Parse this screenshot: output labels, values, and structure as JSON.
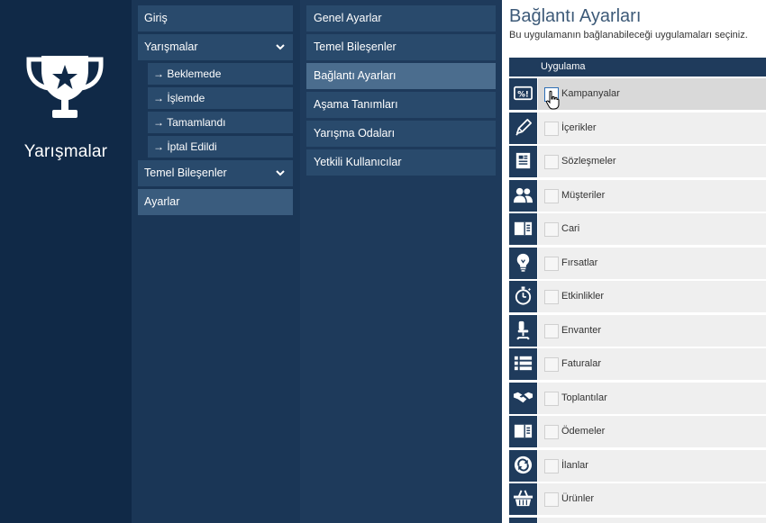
{
  "app": {
    "title": "Yarışmalar",
    "icon": "trophy-icon"
  },
  "menu": {
    "items": [
      {
        "label": "Giriş"
      },
      {
        "label": "Yarışmalar",
        "expanded": true
      },
      {
        "label": "→ Beklemede"
      },
      {
        "label": "→ İşlemde"
      },
      {
        "label": "→ Tamamlandı"
      },
      {
        "label": "→ İptal Edildi"
      },
      {
        "label": "Temel Bileşenler",
        "expanded": false
      },
      {
        "label": "Ayarlar",
        "active": true
      }
    ]
  },
  "submenu": {
    "items": [
      {
        "label": "Genel Ayarlar"
      },
      {
        "label": "Temel Bileşenler"
      },
      {
        "label": "Bağlantı Ayarları",
        "active": true
      },
      {
        "label": "Aşama Tanımları"
      },
      {
        "label": "Yarışma Odaları"
      },
      {
        "label": "Yetkili Kullanıcılar"
      }
    ]
  },
  "content": {
    "title": "Bağlantı Ayarları",
    "subtitle": "Bu uygulamanın bağlanabileceği uygulamaları seçiniz.",
    "column_header": "Uygulama",
    "apps": [
      {
        "label": "Kampanyalar",
        "icon": "percent-tag-icon",
        "checked": false
      },
      {
        "label": "İçerikler",
        "icon": "pencil-icon",
        "checked": false
      },
      {
        "label": "Sözleşmeler",
        "icon": "document-icon",
        "checked": false
      },
      {
        "label": "Müşteriler",
        "icon": "users-icon",
        "checked": false
      },
      {
        "label": "Cari",
        "icon": "ledger-icon",
        "checked": false
      },
      {
        "label": "Fırsatlar",
        "icon": "lightbulb-icon",
        "checked": false
      },
      {
        "label": "Etkinlikler",
        "icon": "stopwatch-icon",
        "checked": false
      },
      {
        "label": "Envanter",
        "icon": "office-chair-icon",
        "checked": false
      },
      {
        "label": "Faturalar",
        "icon": "list-icon",
        "checked": false
      },
      {
        "label": "Toplantılar",
        "icon": "handshake-icon",
        "checked": false
      },
      {
        "label": "Ödemeler",
        "icon": "ledger-icon",
        "checked": false
      },
      {
        "label": "İlanlar",
        "icon": "refresh-circle-icon",
        "checked": false
      },
      {
        "label": "Ürünler",
        "icon": "basket-icon",
        "checked": false
      }
    ]
  },
  "colors": {
    "rail": "#102947",
    "menu_bg": "#1a3656",
    "menu_item": "#294a6c",
    "menu_active": "#3a5c7e",
    "submenu_active": "#4b6d8e",
    "grid_header": "#1f3b5c",
    "title_text": "#3d5a78"
  }
}
